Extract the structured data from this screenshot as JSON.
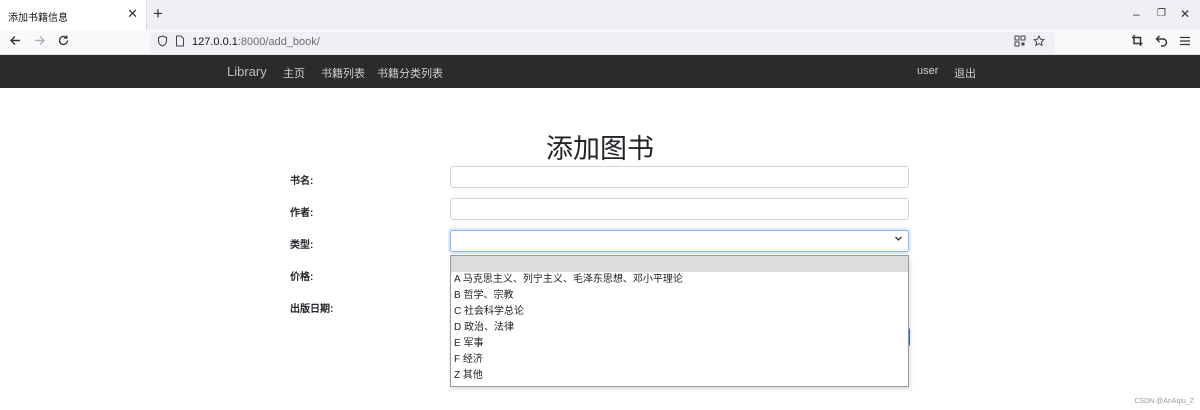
{
  "browser": {
    "tab_title": "添加书籍信息",
    "close_glyph": "✕",
    "new_tab_glyph": "+",
    "url_host": "127.0.0.1",
    "url_rest": ":8000/add_book/",
    "win_min": "–",
    "win_restore": "❐",
    "win_close": "✕"
  },
  "site_nav": {
    "brand": "Library",
    "links": [
      "主页",
      "书籍列表",
      "书籍分类列表"
    ],
    "user": "user",
    "logout": "退出"
  },
  "page": {
    "title": "添加图书",
    "labels": {
      "name": "书名:",
      "author": "作者:",
      "category": "类型:",
      "price": "价格:",
      "pub_date": "出版日期:"
    },
    "category_selected": ""
  },
  "dropdown": {
    "options": [
      "",
      "A 马克思主义、列宁主义、毛泽东思想、邓小平理论",
      "B 哲学、宗教",
      "C 社会科学总论",
      "D 政治、法律",
      "E 军事",
      "F 经济",
      "Z 其他"
    ]
  },
  "watermark": "CSDN @AnAqiu_Z",
  "icons": [
    "close-icon",
    "plus-icon",
    "back-icon",
    "forward-icon",
    "reload-icon",
    "shield-icon",
    "page-icon",
    "qr-code-icon",
    "star-icon",
    "crop-icon",
    "undo-icon",
    "menu-icon",
    "chevron-down-icon"
  ]
}
